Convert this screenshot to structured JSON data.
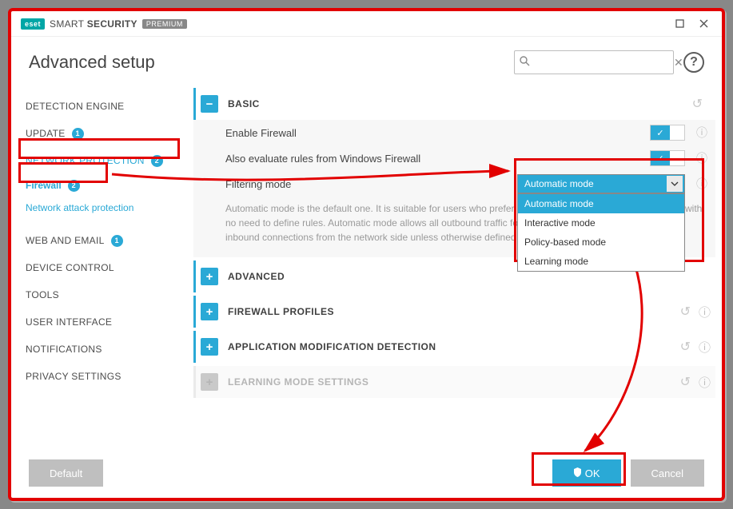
{
  "titlebar": {
    "logo": "eset",
    "brand_light": "SMART",
    "brand_bold": "SECURITY",
    "premium": "PREMIUM"
  },
  "page_title": "Advanced setup",
  "search": {
    "placeholder": "",
    "value": ""
  },
  "sidebar": {
    "items": [
      {
        "label": "DETECTION ENGINE",
        "badge": null
      },
      {
        "label": "UPDATE",
        "badge": "1"
      },
      {
        "label": "NETWORK PROTECTION",
        "badge": "2"
      },
      {
        "label": "WEB AND EMAIL",
        "badge": "1"
      },
      {
        "label": "DEVICE CONTROL",
        "badge": null
      },
      {
        "label": "TOOLS",
        "badge": null
      },
      {
        "label": "USER INTERFACE",
        "badge": null
      },
      {
        "label": "NOTIFICATIONS",
        "badge": null
      },
      {
        "label": "PRIVACY SETTINGS",
        "badge": null
      }
    ],
    "sub": [
      {
        "label": "Firewall",
        "badge": "2"
      },
      {
        "label": "Network attack protection",
        "badge": null
      }
    ]
  },
  "basic": {
    "title": "BASIC",
    "enable_firewall": "Enable Firewall",
    "also_eval": "Also evaluate rules from Windows Firewall",
    "filtering_mode": "Filtering mode",
    "desc": "Automatic mode is the default one. It is suitable for users who prefer easy and convenient use of the firewall with no need to define rules. Automatic mode allows all outbound traffic for the given system and blocks all new inbound connections from the network side unless otherwise defined by custom rules."
  },
  "dropdown": {
    "selected": "Automatic mode",
    "options": [
      "Automatic mode",
      "Interactive mode",
      "Policy-based mode",
      "Learning mode"
    ]
  },
  "sections": {
    "advanced": "ADVANCED",
    "profiles": "FIREWALL PROFILES",
    "appmod": "APPLICATION MODIFICATION DETECTION",
    "learning": "LEARNING MODE SETTINGS"
  },
  "footer": {
    "default": "Default",
    "ok": "OK",
    "cancel": "Cancel"
  }
}
